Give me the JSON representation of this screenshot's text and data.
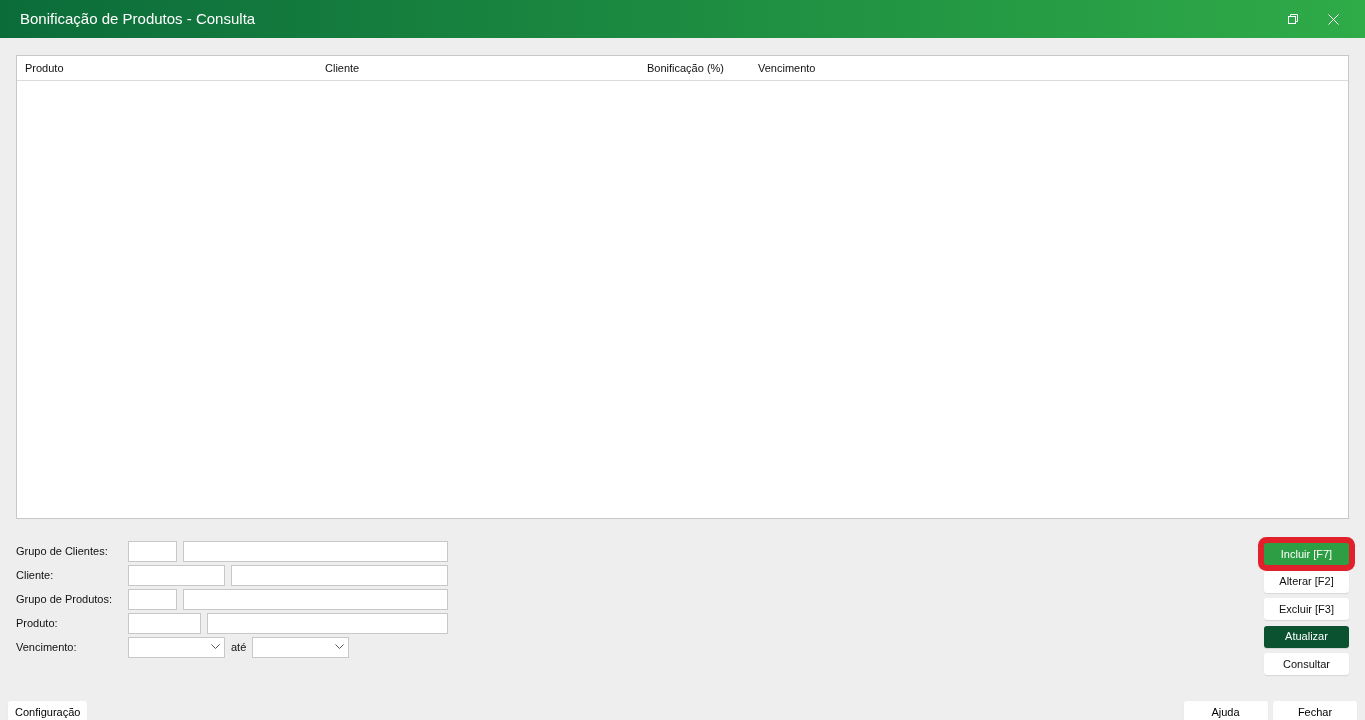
{
  "window": {
    "title": "Bonificação de Produtos - Consulta"
  },
  "table": {
    "columns": [
      {
        "label": "Produto"
      },
      {
        "label": "Cliente"
      },
      {
        "label": "Bonificação (%)"
      },
      {
        "label": "Vencimento"
      }
    ]
  },
  "filters": [
    {
      "label": "Grupo de Clientes:",
      "kind": "code-desc"
    },
    {
      "label": "Cliente:",
      "kind": "code-desc"
    },
    {
      "label": "Grupo de Produtos:",
      "kind": "code-desc"
    },
    {
      "label": "Produto:",
      "kind": "code-desc"
    },
    {
      "label": "Vencimento:",
      "kind": "date-range",
      "between": "até"
    }
  ],
  "actions": [
    {
      "label": "Incluir [F7]",
      "kind": "primary",
      "highlighted": true
    },
    {
      "label": "Alterar [F2]",
      "kind": "default",
      "highlighted": false
    },
    {
      "label": "Excluir [F3]",
      "kind": "default",
      "highlighted": false
    },
    {
      "label": "Atualizar",
      "kind": "dark",
      "highlighted": false
    },
    {
      "label": "Consultar",
      "kind": "default",
      "highlighted": false
    }
  ],
  "footer": {
    "left": [
      "Configuração"
    ],
    "right": [
      "Ajuda",
      "Fechar"
    ]
  }
}
